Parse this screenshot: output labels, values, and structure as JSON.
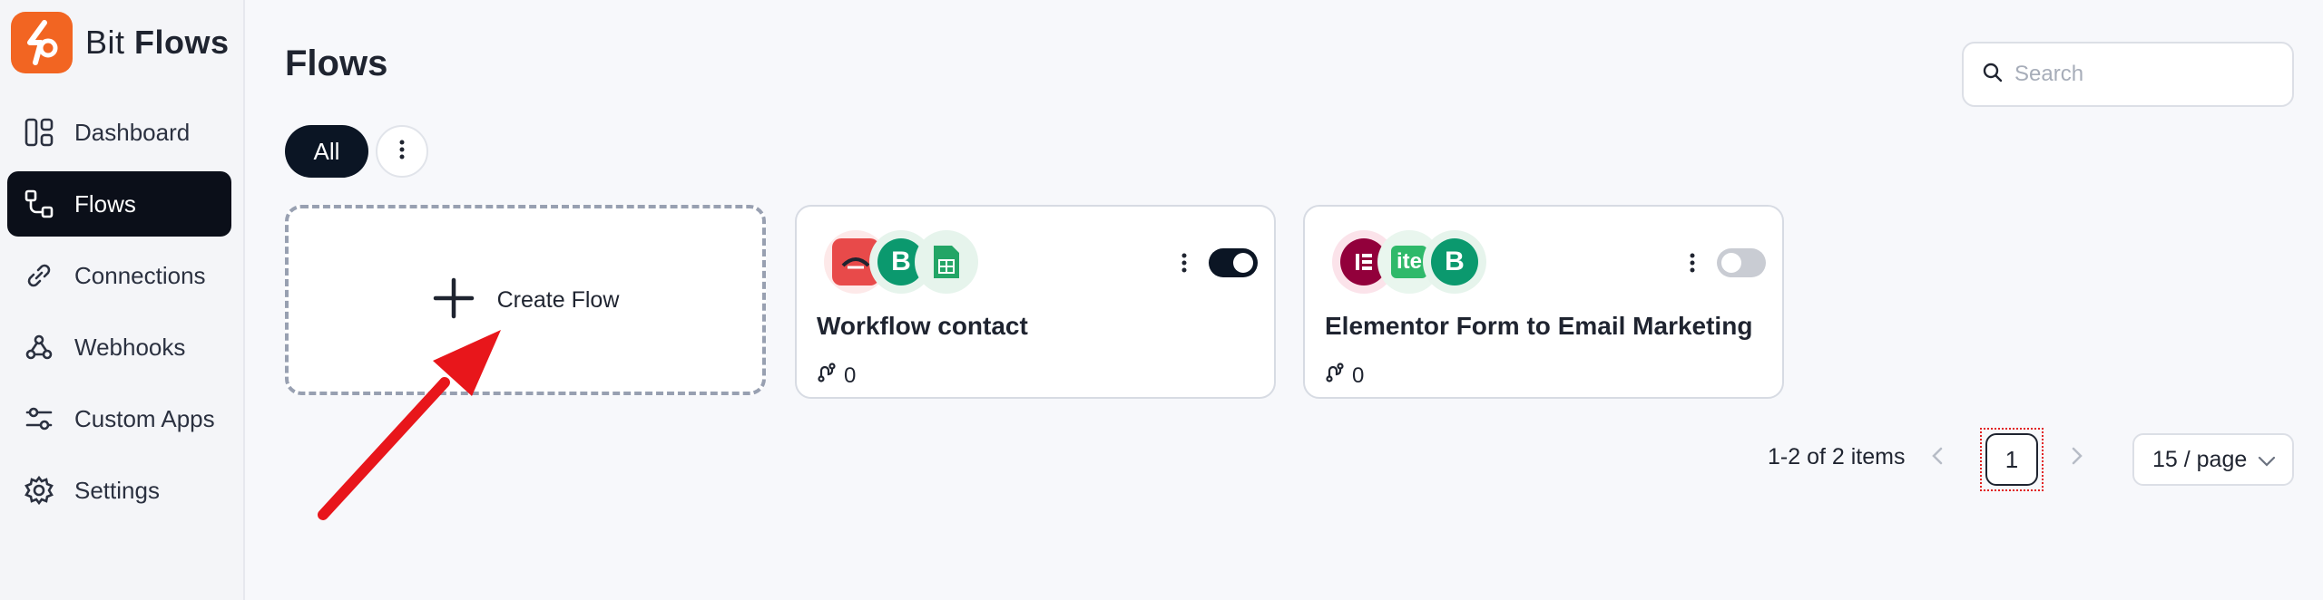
{
  "brand": {
    "name_regular": "Bit ",
    "name_bold": "Flows"
  },
  "sidebar": {
    "items": [
      {
        "label": "Dashboard",
        "icon": "dashboard-icon",
        "active": false
      },
      {
        "label": "Flows",
        "icon": "flows-icon",
        "active": true
      },
      {
        "label": "Connections",
        "icon": "link-icon",
        "active": false
      },
      {
        "label": "Webhooks",
        "icon": "webhook-icon",
        "active": false
      },
      {
        "label": "Custom Apps",
        "icon": "sliders-icon",
        "active": false
      },
      {
        "label": "Settings",
        "icon": "gear-icon",
        "active": false
      }
    ]
  },
  "header": {
    "title": "Flows"
  },
  "search": {
    "placeholder": "Search",
    "value": ""
  },
  "filters": {
    "all_label": "All"
  },
  "create_card": {
    "label": "Create Flow"
  },
  "flows": [
    {
      "name": "Workflow contact",
      "runs": "0",
      "enabled": true,
      "apps": [
        "webform-icon",
        "brevo-icon",
        "google-sheets-icon"
      ]
    },
    {
      "name": "Elementor Form to Email Marketing",
      "runs": "0",
      "enabled": false,
      "apps": [
        "elementor-icon",
        "mailerlite-icon",
        "brevo-icon"
      ],
      "app_labels": {
        "mailerlite": "ite"
      }
    }
  ],
  "pagination": {
    "total_text": "1-2 of 2 items",
    "current_page": "1",
    "page_size": "15 / page"
  },
  "colors": {
    "brand": "#f26522",
    "active_nav": "#0b0f19",
    "annotation_arrow": "#e8161b"
  }
}
